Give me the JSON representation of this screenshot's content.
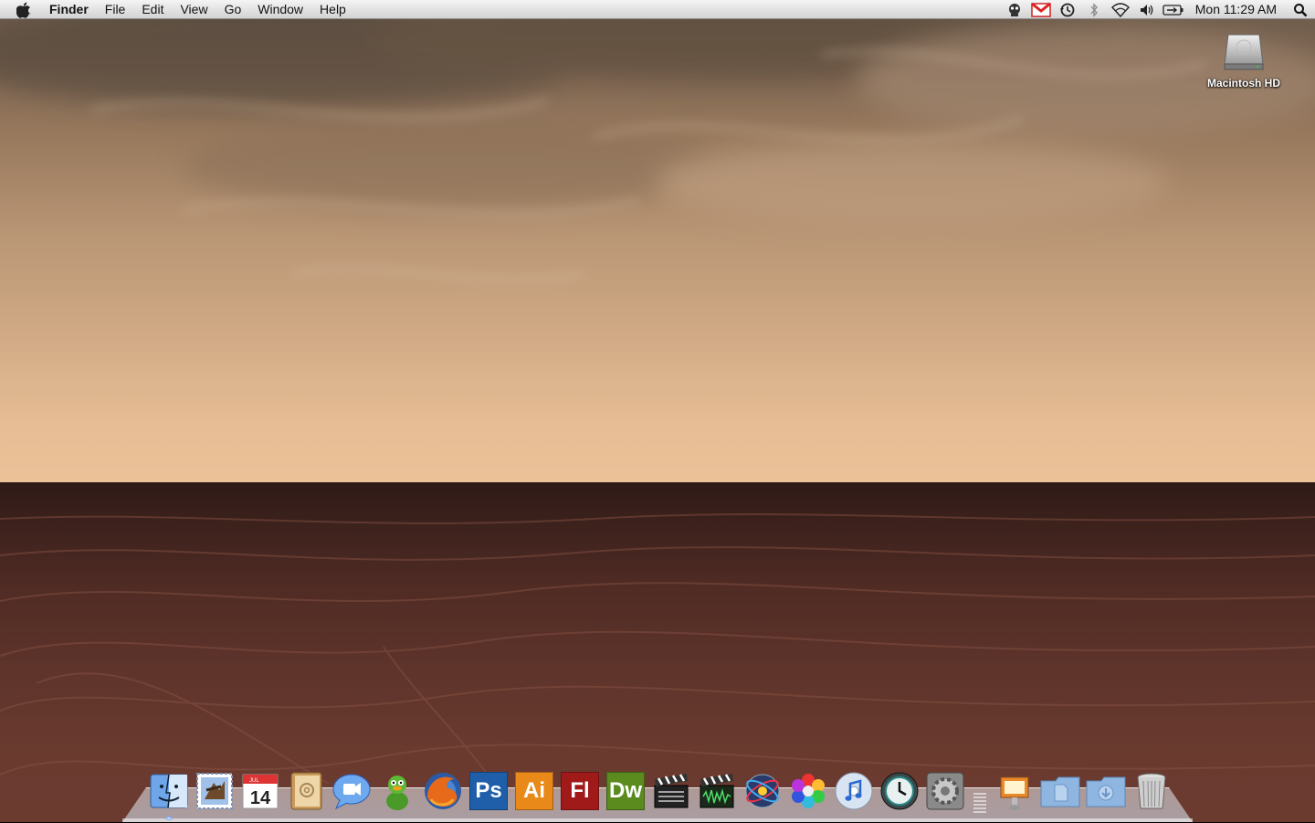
{
  "menubar": {
    "app_name": "Finder",
    "menus": [
      "File",
      "Edit",
      "View",
      "Go",
      "Window",
      "Help"
    ],
    "clock": "Mon 11:29 AM",
    "status_icons": [
      "growl-icon",
      "gmail-notifier-icon",
      "time-machine-icon",
      "bluetooth-icon",
      "wifi-icon",
      "volume-icon",
      "battery-icon"
    ]
  },
  "desktop": {
    "icons": [
      {
        "label": "Macintosh HD",
        "icon": "hard-drive-icon"
      }
    ]
  },
  "dock": {
    "calendar_month": "JUL",
    "calendar_day": "14",
    "apps": [
      "finder",
      "mail",
      "ical",
      "address-book",
      "ichat",
      "adium",
      "firefox",
      "photoshop",
      "illustrator",
      "flash",
      "dreamweaver",
      "final-cut",
      "soundtrack",
      "motion",
      "color",
      "itunes",
      "time-machine",
      "system-preferences"
    ],
    "adobe_labels": {
      "photoshop": "Ps",
      "illustrator": "Ai",
      "flash": "Fl",
      "dreamweaver": "Dw"
    },
    "right_items": [
      "preview-stack",
      "documents-folder",
      "downloads-folder",
      "trash"
    ],
    "colors": {
      "photoshop": "#1f5ea8",
      "illustrator": "#e8891a",
      "flash": "#a11a1a",
      "dreamweaver": "#5b8a1e"
    }
  }
}
